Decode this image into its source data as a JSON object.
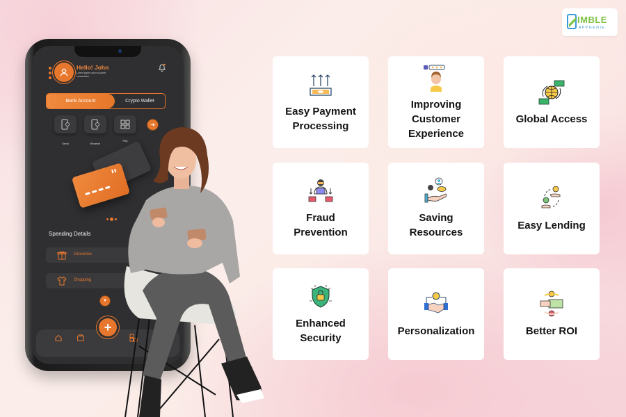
{
  "brand": {
    "logo_word": "IMBLE",
    "logo_sub": "APPGENIE",
    "colors": {
      "green": "#7dc242",
      "blue": "#3a9bd8"
    }
  },
  "phone_app": {
    "greeting": "Hello! John",
    "greeting_sub": "Lorem ipsum dolor sit amet consectetur",
    "account_tabs": [
      {
        "label": "Bank Account",
        "active": true
      },
      {
        "label": "Crypto Wallet",
        "active": false
      }
    ],
    "quick_actions": [
      {
        "label": "Send",
        "icon": "phone-send-icon"
      },
      {
        "label": "Receive",
        "icon": "phone-receive-icon"
      },
      {
        "label": "Pay",
        "icon": "qr-code-icon"
      }
    ],
    "spending_title": "Spending Details",
    "spending_items": [
      {
        "label": "Groceries",
        "icon": "gift-icon"
      },
      {
        "label": "Shopping",
        "icon": "shirt-icon"
      }
    ],
    "fab_label": "+",
    "nav_items": [
      "home-icon",
      "wallet-icon",
      "dashboard-icon",
      "settings-sliders-icon"
    ],
    "accent_color": "#e8772e"
  },
  "features": [
    {
      "label": "Easy Payment\nProcessing",
      "icon": "payment-arrows-icon"
    },
    {
      "label": "Improving\nCustomer\nExperience",
      "icon": "customer-rating-icon"
    },
    {
      "label": "Global Access",
      "icon": "globe-money-icon"
    },
    {
      "label": "Fraud\nPrevention",
      "icon": "hacker-laptop-icon"
    },
    {
      "label": "Saving\nResources",
      "icon": "hand-resources-icon"
    },
    {
      "label": "Easy Lending",
      "icon": "lending-hands-icon"
    },
    {
      "label": "Enhanced\nSecurity",
      "icon": "shield-lock-icon"
    },
    {
      "label": "Personalization",
      "icon": "handshake-dollar-icon"
    },
    {
      "label": "Better ROI",
      "icon": "roi-cheque-icon"
    }
  ]
}
